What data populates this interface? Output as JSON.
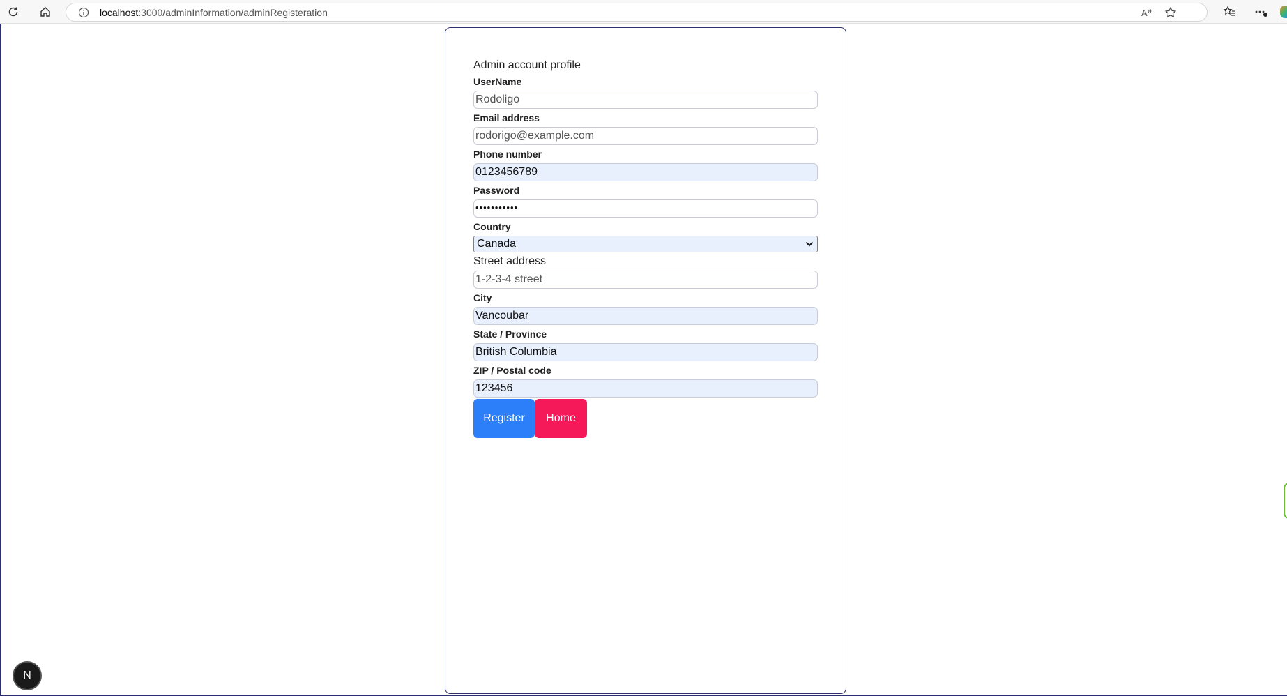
{
  "browser": {
    "url_host": "localhost",
    "url_path": ":3000/adminInformation/adminRegisteration",
    "icons": [
      "refresh-icon",
      "home-icon",
      "info-icon",
      "read-aloud-icon",
      "star-icon",
      "favorites-icon",
      "more-icon"
    ]
  },
  "form": {
    "title": "Admin account profile",
    "username_label": "UserName",
    "username_value": "Rodoligo",
    "email_label": "Email address",
    "email_value": "rodorigo@example.com",
    "phone_label": "Phone number",
    "phone_value": "0123456789",
    "password_label": "Password",
    "password_value": "•••••••••••",
    "country_label": "Country",
    "country_value": "Canada",
    "street_label": "Street address",
    "street_value": "1-2-3-4 street",
    "city_label": "City",
    "city_value": "Vancoubar",
    "state_label": "State / Province",
    "state_value": "British Columbia",
    "zip_label": "ZIP / Postal code",
    "zip_value": "123456",
    "register_label": "Register",
    "home_label": "Home"
  },
  "overlay": {
    "badge_letter": "N"
  },
  "colors": {
    "register": "#2d7ff9",
    "home": "#f5195a",
    "autofill": "#e8f0fe",
    "card_border": "#2a2f6e"
  }
}
